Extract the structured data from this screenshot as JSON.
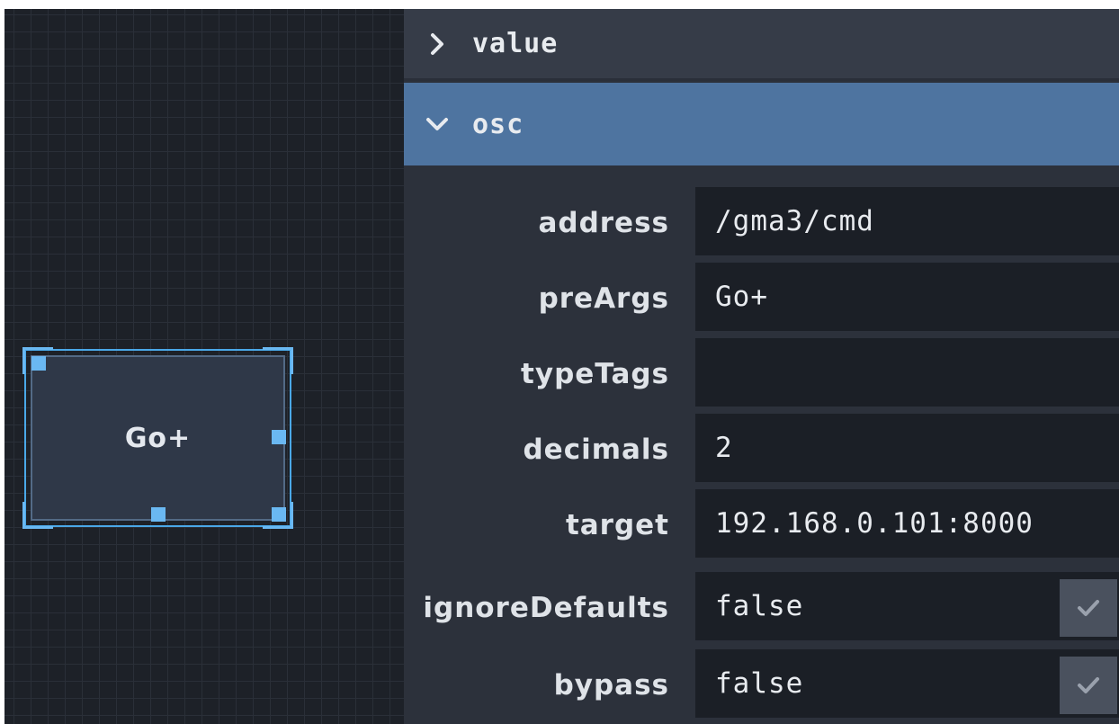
{
  "canvas": {
    "widget": {
      "label": "Go+"
    }
  },
  "inspector": {
    "sections": [
      {
        "title": "value",
        "expanded": false,
        "icon": "chevron-right-icon"
      },
      {
        "title": "osc",
        "expanded": true,
        "icon": "chevron-down-icon"
      }
    ],
    "osc_fields": [
      {
        "label": "address",
        "value": "/gma3/cmd"
      },
      {
        "label": "preArgs",
        "value": "Go+"
      },
      {
        "label": "typeTags",
        "value": ""
      },
      {
        "label": "decimals",
        "value": "2"
      },
      {
        "label": "target",
        "value": "192.168.0.101:8000"
      },
      {
        "label": "ignoreDefaults",
        "value": "false",
        "checkbox_icon": "checkmark-icon"
      },
      {
        "label": "bypass",
        "value": "false",
        "checkbox_icon": "checkmark-icon"
      }
    ]
  },
  "colors": {
    "accent": "#4e74a0",
    "selection": "#4aa8e8",
    "canvas_bg": "#1d2128",
    "panel_bg": "#2c313b"
  }
}
